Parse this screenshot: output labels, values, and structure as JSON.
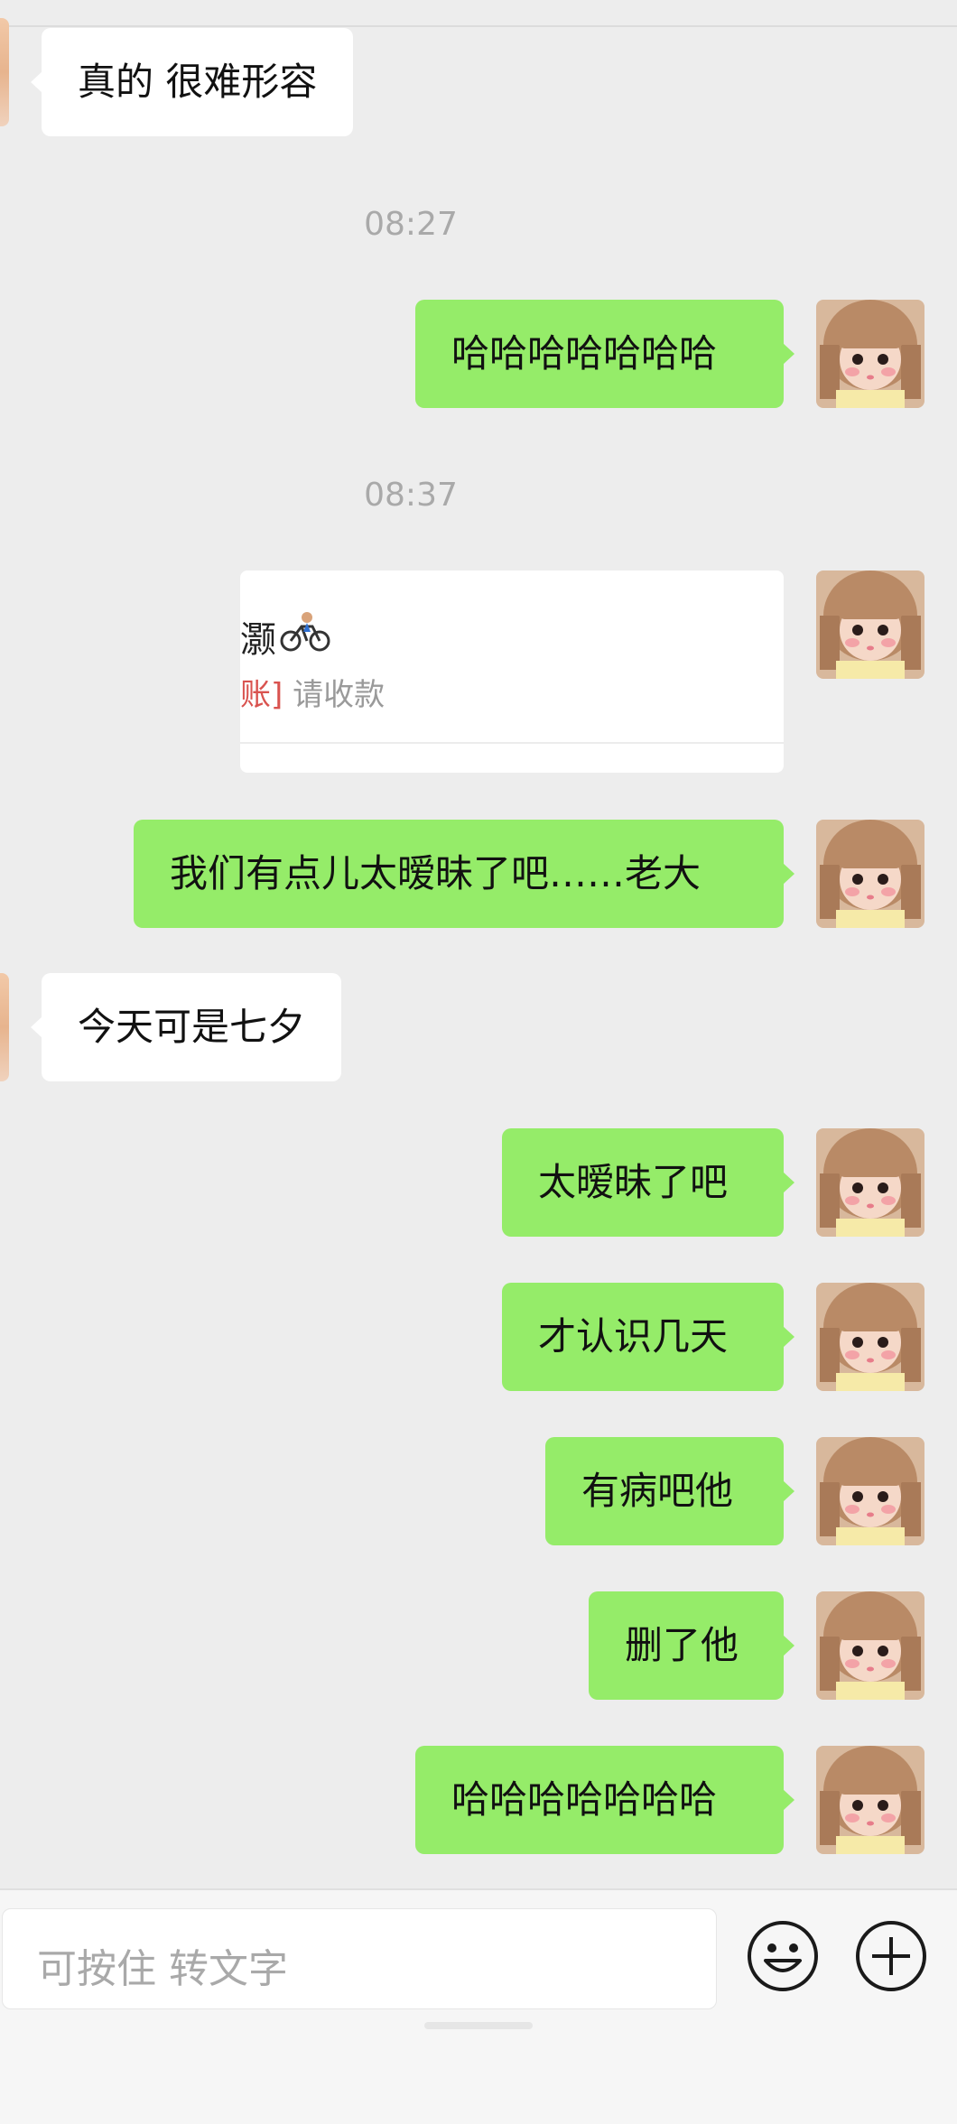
{
  "messages": {
    "m1": "真的 很难形容",
    "t1": "08:27",
    "m2": "哈哈哈哈哈哈哈",
    "t2": "08:37",
    "transfer": {
      "name": "灏",
      "tag": "账]",
      "status": "请收款"
    },
    "m3": "我们有点儿太暧昧了吧……老大",
    "m4": "今天可是七夕",
    "m5": "太暧昧了吧",
    "m6": "才认识几天",
    "m7": "有病吧他",
    "m8": "删了他",
    "m9": "哈哈哈哈哈哈哈"
  },
  "input": {
    "placeholder": "可按住 转文字"
  },
  "icons": [
    "emoji-icon",
    "plus-icon",
    "bike-icon"
  ],
  "colors": {
    "my_bubble": "#95ec69",
    "other_bubble": "#ffffff",
    "background": "#ededed"
  }
}
